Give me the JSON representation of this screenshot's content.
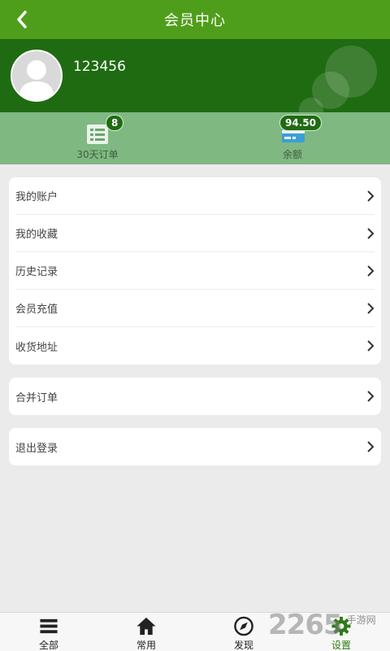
{
  "header": {
    "title": "会员中心",
    "back_icon": "chevron-left-icon"
  },
  "profile": {
    "username": "123456",
    "avatar_icon": "user-avatar-icon"
  },
  "stats": [
    {
      "label": "30天订单",
      "badge": "8",
      "icon": "list-icon"
    },
    {
      "label": "余额",
      "badge": "94.50",
      "icon": "card-icon"
    }
  ],
  "menu_group_1": [
    {
      "label": "我的账户"
    },
    {
      "label": "我的收藏"
    },
    {
      "label": "历史记录"
    },
    {
      "label": "会员充值"
    },
    {
      "label": "收货地址"
    }
  ],
  "menu_group_2": [
    {
      "label": "合并订单"
    }
  ],
  "menu_group_3": [
    {
      "label": "退出登录"
    }
  ],
  "bottom_nav": [
    {
      "label": "全部",
      "icon": "menu-icon"
    },
    {
      "label": "常用",
      "icon": "home-icon"
    },
    {
      "label": "发现",
      "icon": "compass-icon"
    },
    {
      "label": "设置",
      "icon": "gear-icon",
      "active": true
    }
  ],
  "watermark": {
    "number": "2265",
    "text": "手游网"
  },
  "colors": {
    "topbar": "#4f9e1b",
    "profile": "#1f6b12",
    "stats": "#80b882",
    "active": "#2d7a16"
  }
}
